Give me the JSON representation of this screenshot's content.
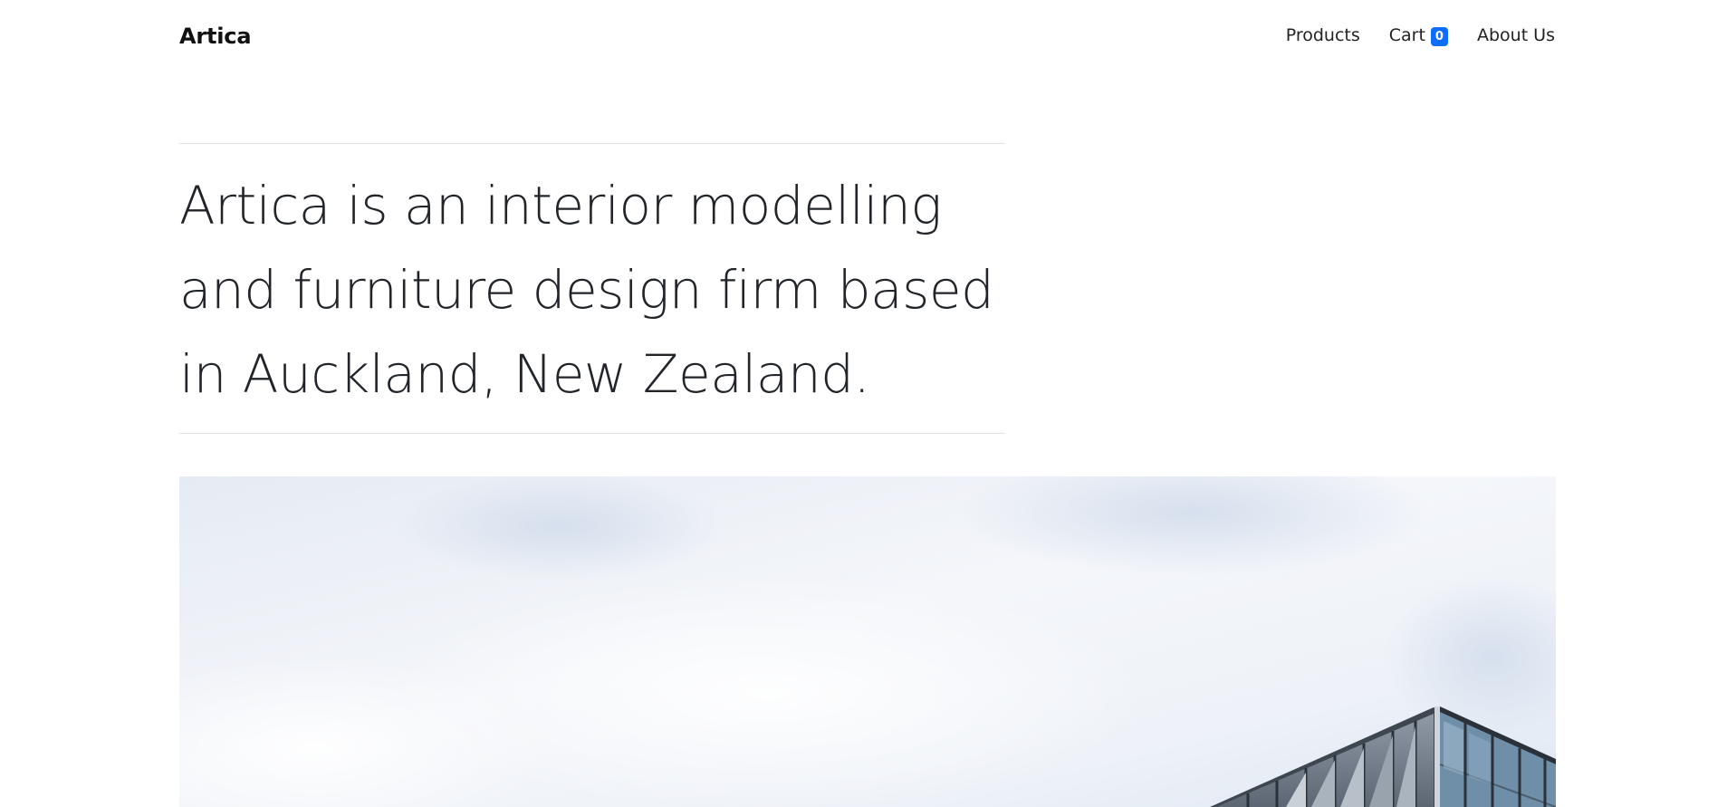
{
  "navbar": {
    "brand": "Artica",
    "links": {
      "products": "Products",
      "cart": "Cart",
      "cart_count": "0",
      "about": "About Us"
    }
  },
  "hero": {
    "heading": "Artica is an interior modelling and furniture design firm based in Auckland, New Zealand."
  },
  "colors": {
    "badge": "#0d6efd",
    "text": "#212529",
    "rule": "#dee2e6"
  }
}
